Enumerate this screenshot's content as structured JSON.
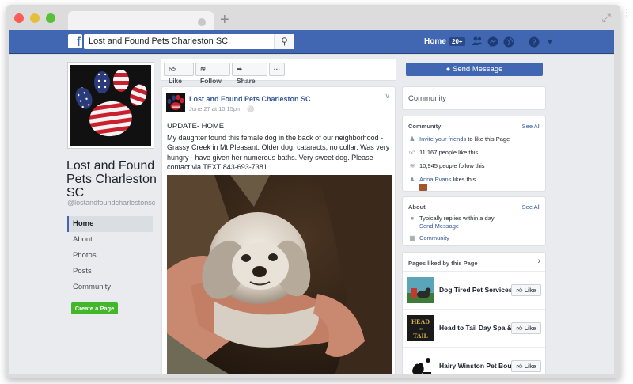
{
  "browser": {
    "new_tab": "+",
    "expand_icon": "expand-arrows-icon"
  },
  "topbar": {
    "logo": "f",
    "search_value": "Lost and Found Pets Charleston SC",
    "home_label": "Home",
    "home_badge": "20+",
    "icons": [
      "friends-icon",
      "messenger-icon",
      "globe-icon",
      "help-icon",
      "caret-down-icon"
    ],
    "brand_color": "#4267b2"
  },
  "page": {
    "name": "Lost and Found Pets Charleston SC",
    "handle": "@lostandfoundcharlestonsc",
    "nav": [
      {
        "label": "Home",
        "active": true
      },
      {
        "label": "About"
      },
      {
        "label": "Photos"
      },
      {
        "label": "Posts"
      },
      {
        "label": "Community"
      }
    ],
    "create_page": "Create a Page"
  },
  "actions": {
    "like": "Like",
    "follow": "Follow",
    "share": "Share",
    "more": "···",
    "send_message": "Send Message"
  },
  "post": {
    "author": "Lost and Found Pets Charleston SC",
    "meta": "June 27 at 10:15pm · ",
    "heading": "UPDATE- HOME",
    "body": "My daughter found this female dog in the back of our neighborhood - Grassy Creek in Mt Pleasant. Older dog, cataracts, no collar. Was very hungry - have given her numerous baths. Very sweet dog. Please contact via TEXT 843-693-7381"
  },
  "sidebar": {
    "community_header": "Community",
    "community": {
      "title": "Community",
      "see_all": "See All",
      "invite": "Invite your friends",
      "invite_rest": " to like this Page",
      "likes": "11,167 people like this",
      "follows": "10,945 people follow this",
      "friend_name": "Anna Evans",
      "friend_rest": " likes this"
    },
    "about": {
      "title": "About",
      "see_all": "See All",
      "reply": "Typically replies within a day",
      "send_message": "Send Message",
      "category": "Community"
    },
    "liked": {
      "title": "Pages liked by this Page",
      "like_label": "Like",
      "pages": [
        {
          "name": "Dog Tired Pet Services"
        },
        {
          "name": "Head to Tail Day Spa &..."
        },
        {
          "name": "Hairy Winston Pet Bou..."
        }
      ],
      "thumb_text": [
        "HEAD",
        "to",
        "TAIL"
      ]
    }
  }
}
